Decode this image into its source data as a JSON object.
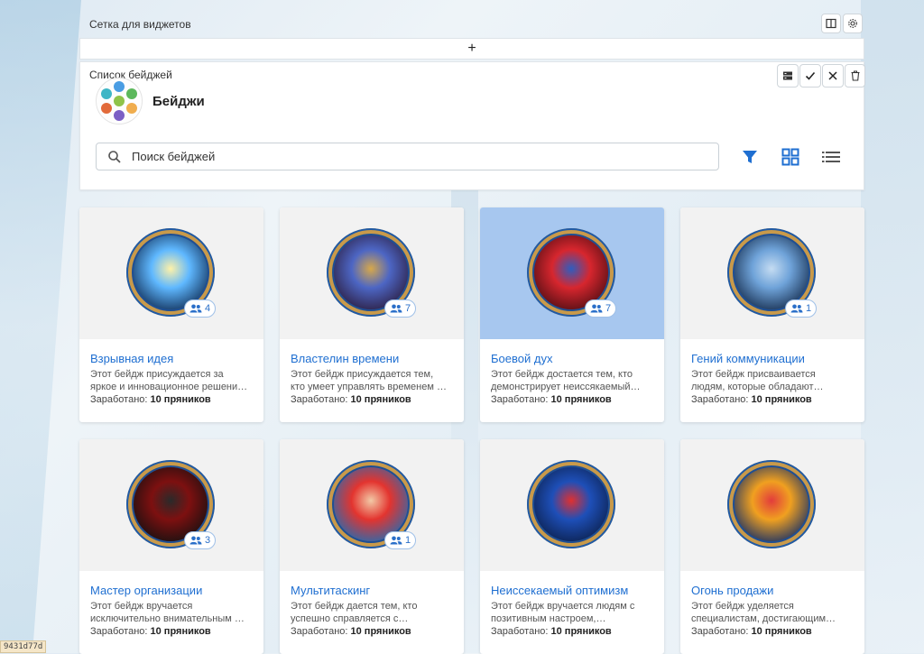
{
  "widget_grid": {
    "title": "Сетка для виджетов",
    "add_label": "+"
  },
  "badge_list": {
    "panel_title": "Список бейджей",
    "heading": "Бейджи",
    "search_placeholder": "Поиск бейджей"
  },
  "earned_label": "Заработано:",
  "cards": [
    {
      "title": "Взрывная идея",
      "desc1": "Этот бейдж присуждается за",
      "desc2": "яркое и инновационное решени…",
      "earned": "10 пряников",
      "count": "4",
      "icon": "lightbulb-badge-icon"
    },
    {
      "title": "Властелин времени",
      "desc1": "Этот бейдж присуждается тем,",
      "desc2": "кто умеет управлять временем …",
      "earned": "10 пряников",
      "count": "7",
      "icon": "hourglass-badge-icon"
    },
    {
      "title": "Боевой дух",
      "desc1": "Этот бейдж достается тем, кто",
      "desc2": "демонстрирует неиссякаемый…",
      "earned": "10 пряников",
      "count": "7",
      "icon": "warrior-badge-icon",
      "selected": true
    },
    {
      "title": "Гений коммуникации",
      "desc1": "Этот бейдж присваивается",
      "desc2": "людям, которые обладают…",
      "earned": "10 пряников",
      "count": "1",
      "icon": "robot-faces-badge-icon"
    },
    {
      "title": "Мастер организации",
      "desc1": "Этот бейдж вручается",
      "desc2": "исключительно внимательным …",
      "earned": "10 пряников",
      "count": "3",
      "icon": "hooded-figure-badge-icon"
    },
    {
      "title": "Мультитаскинг",
      "desc1": "Этот бейдж дается тем, кто",
      "desc2": "успешно справляется с…",
      "earned": "10 пряников",
      "count": "1",
      "icon": "redhead-girl-badge-icon"
    },
    {
      "title": "Неиссекаемый оптимизм",
      "desc1": "Этот бейдж вручается людям с",
      "desc2": "позитивным настроем,…",
      "earned": "10 пряников",
      "count": "",
      "icon": "cube-badge-icon"
    },
    {
      "title": "Огонь продажи",
      "desc1": "Этот бейдж уделяется",
      "desc2": "специалистам, достигающим…",
      "earned": "10 пряников",
      "count": "",
      "icon": "fireworks-cart-badge-icon"
    }
  ],
  "hash_label": "9431d77d"
}
